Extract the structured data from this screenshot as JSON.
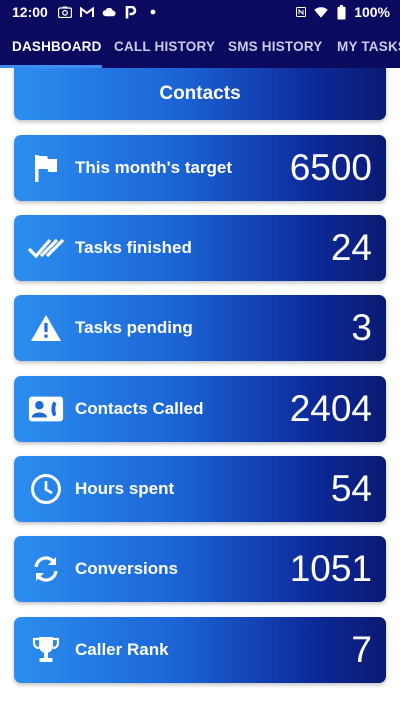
{
  "status_bar": {
    "time": "12:00",
    "battery": "100%",
    "icons": [
      "camera-icon",
      "gmail-icon",
      "cloud-icon",
      "pocket-icon",
      "dot-icon",
      "nfc-icon",
      "wifi-icon",
      "battery-icon"
    ]
  },
  "tabs": [
    {
      "label": "DASHBOARD",
      "active": true
    },
    {
      "label": "CALL HISTORY",
      "active": false
    },
    {
      "label": "SMS HISTORY",
      "active": false
    },
    {
      "label": "MY TASKS",
      "active": false
    }
  ],
  "header": {
    "title": "Contacts"
  },
  "stats": [
    {
      "label": "This month's target",
      "value": "6500",
      "icon": "flag-icon"
    },
    {
      "label": "Tasks finished",
      "value": "24",
      "icon": "double-check-icon"
    },
    {
      "label": "Tasks pending",
      "value": "3",
      "icon": "warning-icon"
    },
    {
      "label": "Contacts Called",
      "value": "2404",
      "icon": "contact-call-icon"
    },
    {
      "label": "Hours spent",
      "value": "54",
      "icon": "clock-icon"
    },
    {
      "label": "Conversions",
      "value": "1051",
      "icon": "sync-icon"
    },
    {
      "label": "Caller Rank",
      "value": "7",
      "icon": "trophy-icon"
    }
  ],
  "colors": {
    "app_bar": "#0b0a5e",
    "card_start": "#2c8ef0",
    "card_end": "#0a1a72",
    "tab_indicator": "#3f8cf0"
  }
}
